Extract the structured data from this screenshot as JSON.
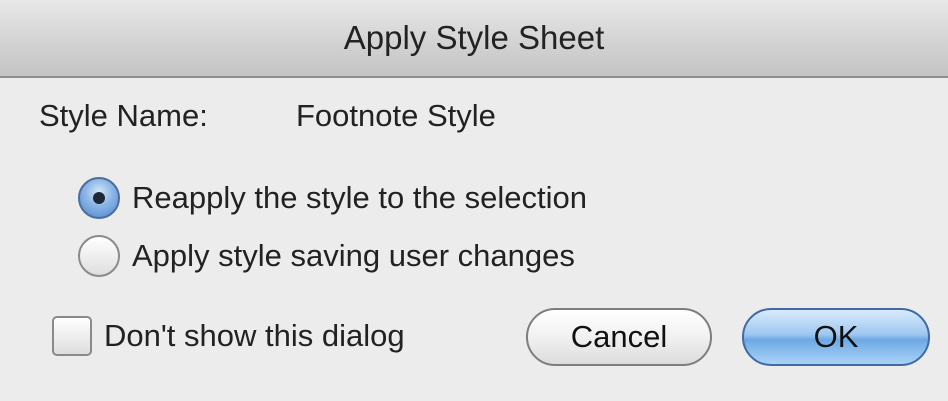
{
  "window": {
    "title": "Apply Style Sheet"
  },
  "style": {
    "label": "Style Name:",
    "value": "Footnote Style"
  },
  "options": {
    "reapply_label": "Reapply the style to the selection",
    "reapply_selected": true,
    "save_changes_label": "Apply style saving user changes",
    "save_changes_selected": false
  },
  "dont_show": {
    "label": "Don't show this dialog",
    "checked": false
  },
  "buttons": {
    "cancel_label": "Cancel",
    "ok_label": "OK"
  },
  "colors": {
    "default_button": "#9fc8f0",
    "selected_radio": "#4d86cf"
  },
  "icons": {
    "radio_selected": "radio-selected-icon",
    "radio_unselected": "radio-unselected-icon",
    "checkbox_unchecked": "checkbox-unchecked-icon"
  }
}
